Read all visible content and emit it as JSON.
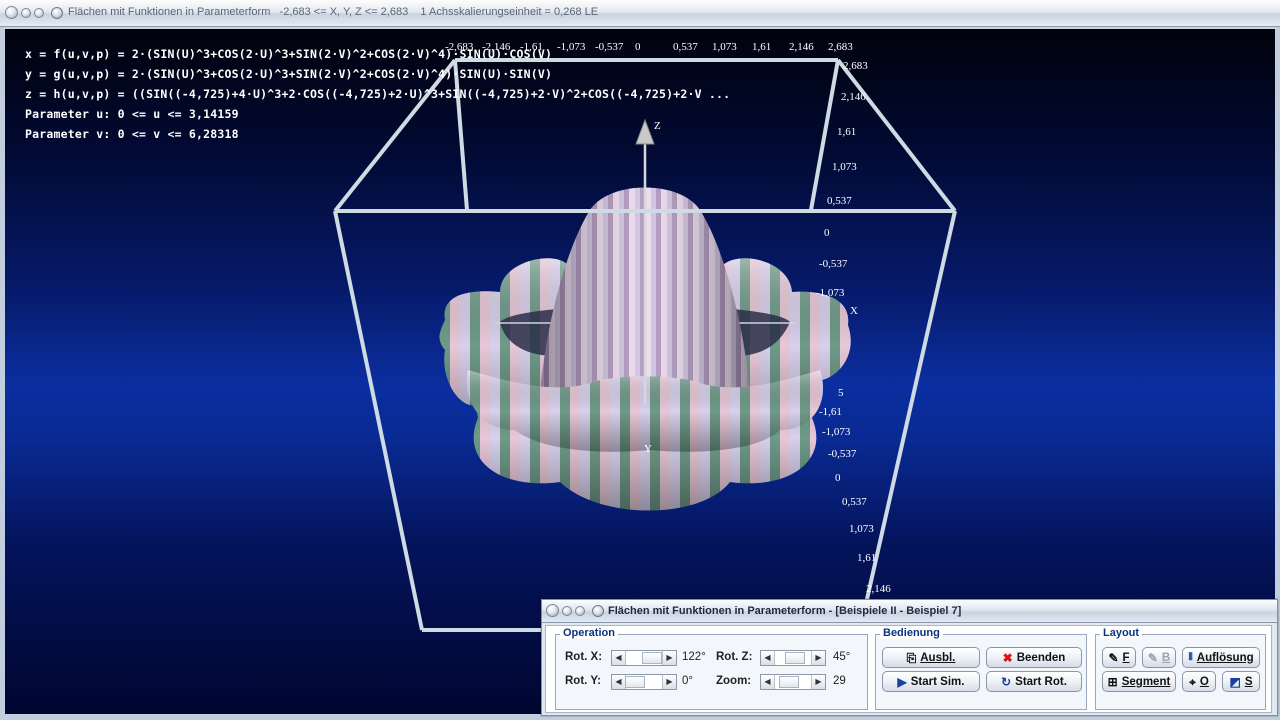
{
  "main_window": {
    "title": "Flächen mit Funktionen in Parameterform",
    "range": "-2,683 <= X, Y, Z <= 2,683",
    "scale": "1 Achsskalierungseinheit = 0,268 LE"
  },
  "info_lines": [
    "x = f(u,v,p) = 2·(SIN(U)^3+COS(2·U)^3+SIN(2·V)^2+COS(2·V)^4)·SIN(U)·COS(V)",
    "y = g(u,v,p) = 2·(SIN(U)^3+COS(2·U)^3+SIN(2·V)^2+COS(2·V)^4)·SIN(U)·SIN(V)",
    "z = h(u,v,p) = ((SIN((-4,725)+4·U)^3+2·COS((-4,725)+2·U)^3+SIN((-4,725)+2·V)^2+COS((-4,725)+2·V ...",
    "Parameter u: 0 <= u <= 3,14159",
    "Parameter v: 0 <= v <= 6,28318"
  ],
  "axes": {
    "x_label": "X",
    "y_label": "Y",
    "z_label": "Z",
    "top_ticks": [
      "-2,683",
      "-2,146",
      "-1,61",
      "-1,073",
      "-0,537",
      "0",
      "0,537",
      "1,073",
      "1,61",
      "2,146",
      "2,683"
    ],
    "right_upper_ticks": [
      "2,683",
      "2,146",
      "1,61",
      "1,073",
      "0,537",
      "0",
      "-0,537",
      "-1,073"
    ],
    "right_lower_ticks": [
      "-1,61",
      "-1,073",
      "-0,537",
      "0",
      "0,537",
      "1,073",
      "1,61",
      "2,146"
    ],
    "partial_tick": "5"
  },
  "control_window": {
    "title": "Flächen mit Funktionen in Parameterform - [Beispiele II - Beispiel 7]",
    "operation": {
      "title": "Operation",
      "rot_x_label": "Rot. X:",
      "rot_x_value": "122°",
      "rot_y_label": "Rot. Y:",
      "rot_y_value": "0°",
      "rot_z_label": "Rot. Z:",
      "rot_z_value": "45°",
      "zoom_label": "Zoom:",
      "zoom_value": "29"
    },
    "bedienung": {
      "title": "Bedienung",
      "ausbl": "Ausbl.",
      "beenden": "Beenden",
      "start_sim": "Start Sim.",
      "start_rot": "Start Rot."
    },
    "layout": {
      "title": "Layout",
      "f": "F",
      "b": "B",
      "aufloesung": "Auflösung",
      "segment": "Segment",
      "o": "O",
      "s": "S"
    }
  },
  "colors": {
    "background_top": "#00020c",
    "background_mid": "#0b2ea0",
    "surface_pink": "#e8c8d8",
    "surface_green": "#6e9a88",
    "surface_lavender": "#d8d0ec",
    "box_lines": "#cfdbe3"
  }
}
